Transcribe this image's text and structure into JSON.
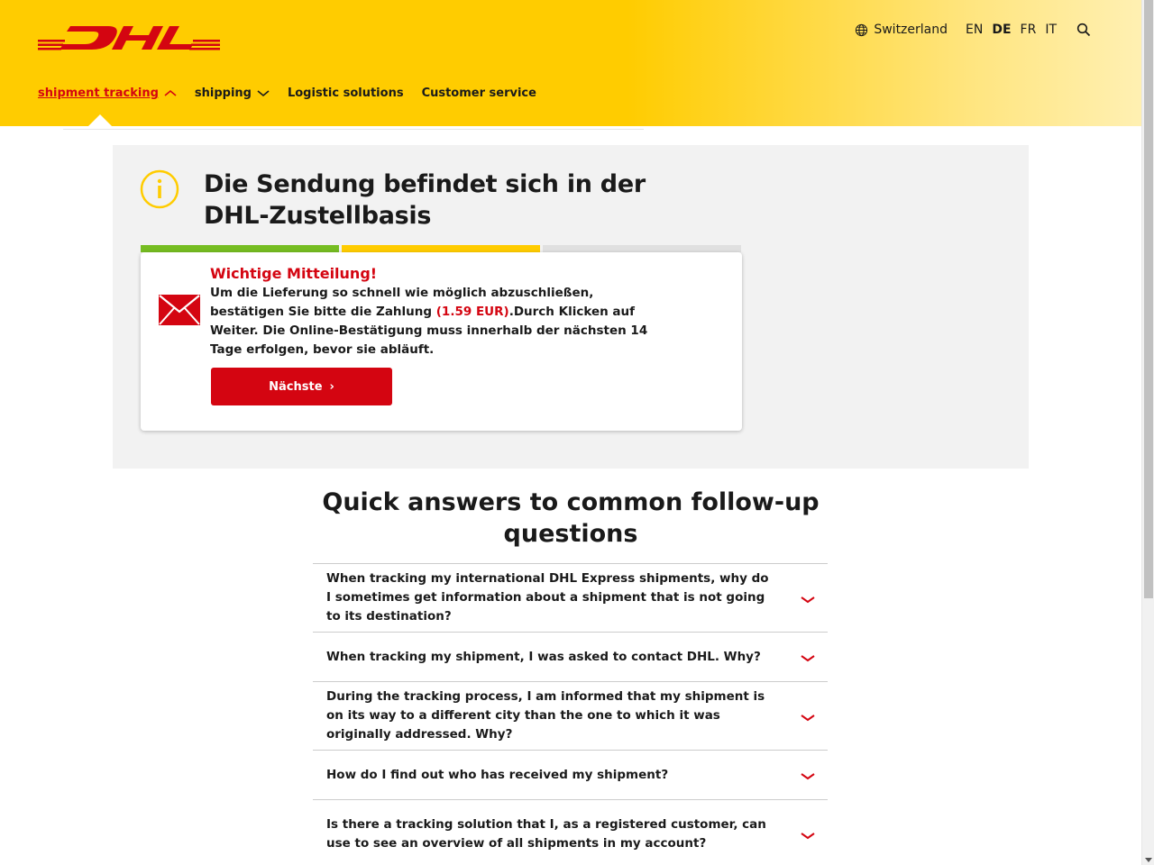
{
  "header": {
    "logo_text": "DHL",
    "country": "Switzerland",
    "languages": [
      {
        "code": "EN",
        "active": false
      },
      {
        "code": "DE",
        "active": true
      },
      {
        "code": "FR",
        "active": false
      },
      {
        "code": "IT",
        "active": false
      }
    ],
    "nav": [
      {
        "label": "shipment tracking",
        "active": true,
        "chevron": "chevron-up"
      },
      {
        "label": "shipping",
        "active": false,
        "chevron": "chevron-down"
      },
      {
        "label": "Logistic solutions",
        "active": false
      },
      {
        "label": "Customer service",
        "active": false
      }
    ]
  },
  "status": {
    "title": "Die Sendung befindet sich in der DHL-Zustellbasis",
    "progress_segments": [
      "complete",
      "current",
      "pending"
    ]
  },
  "notice": {
    "title": "Wichtige Mitteilung!",
    "text_before": "Um die Lieferung so schnell wie möglich abzuschließen, bestätigen Sie bitte die Zahlung ",
    "amount": "(1.59 EUR)",
    "text_after": ".Durch Klicken auf Weiter. Die Online-Bestätigung muss innerhalb der nächsten 14 Tage erfolgen, bevor sie abläuft.",
    "button_label": "Nächste",
    "button_icon": "›"
  },
  "faq": {
    "title": "Quick answers to common follow-up questions",
    "items": [
      "When tracking my international DHL Express shipments, why do I sometimes get information about a shipment that is not going to its destination?",
      "When tracking my shipment, I was asked to contact DHL. Why?",
      "During the tracking process, I am informed that my shipment is on its way to a different city than the one to which it was originally addressed. Why?",
      "How do I find out who has received my shipment?",
      "Is there a tracking solution that I, as a registered customer, can use to see an overview of all shipments in my account?"
    ]
  },
  "colors": {
    "brand_yellow": "#ffcc00",
    "brand_red": "#d40511",
    "progress_green": "#76bd22"
  }
}
